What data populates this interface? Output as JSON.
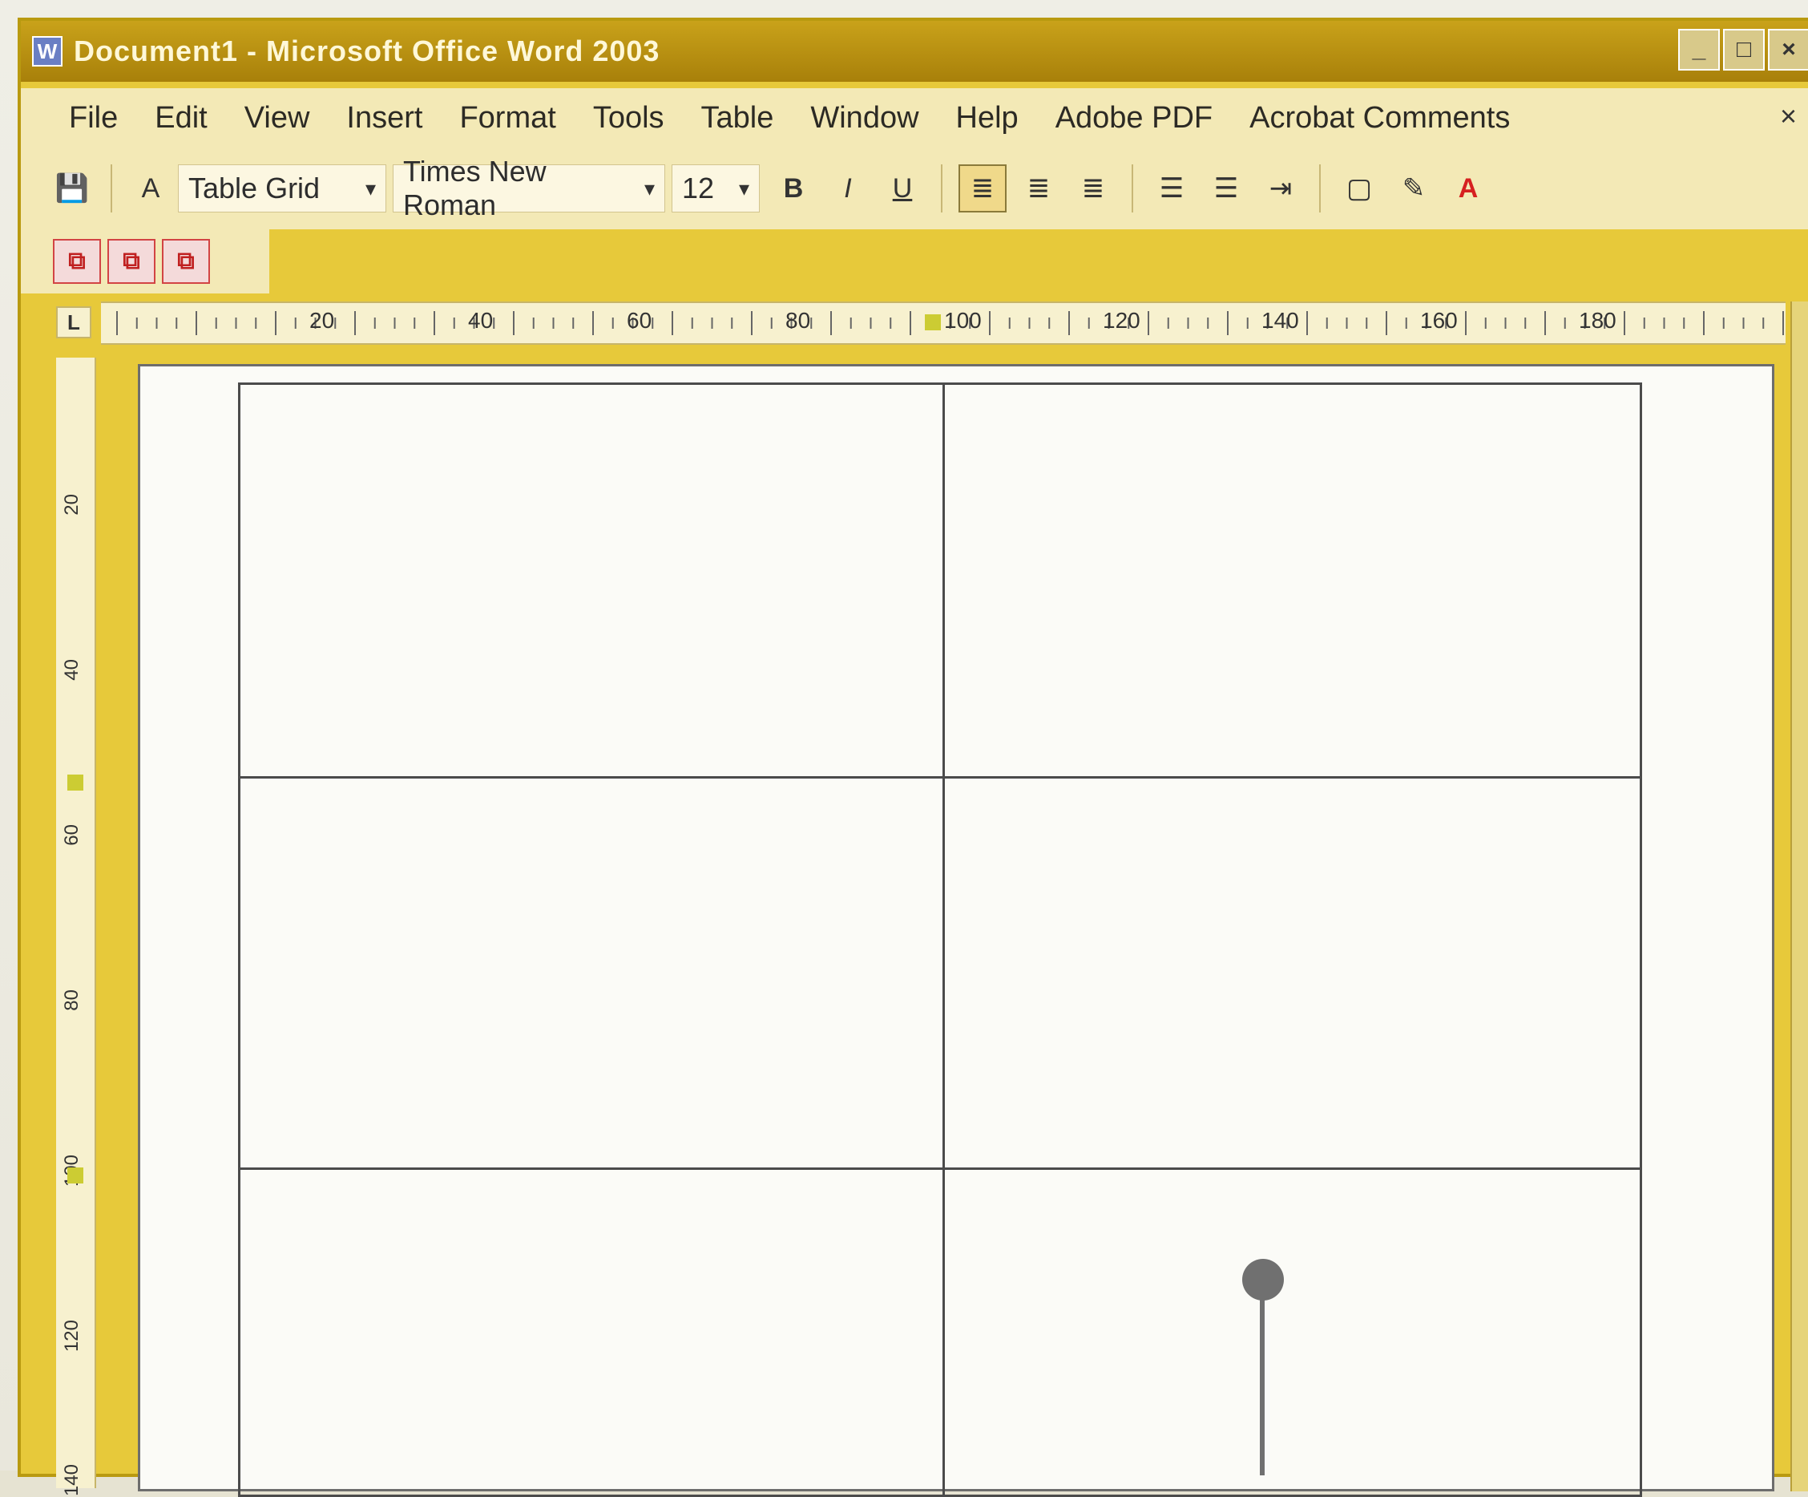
{
  "window": {
    "title": "Document1 - Microsoft Office Word 2003",
    "icon": "word-document-icon"
  },
  "menu": [
    "File",
    "Edit",
    "View",
    "Insert",
    "Format",
    "Tools",
    "Table",
    "Window",
    "Help",
    "Adobe PDF",
    "Acrobat Comments"
  ],
  "toolbar": {
    "style": "Table Grid",
    "font": "Times New Roman",
    "size": "12",
    "bold": "B",
    "italic": "I",
    "underline": "U",
    "font_color_letter": "A"
  },
  "ruler_labels": [
    "20",
    "40",
    "60",
    "80",
    "100",
    "120",
    "140",
    "160",
    "180"
  ],
  "vertical_ruler_labels": [
    "20",
    "40",
    "60",
    "80",
    "100",
    "120",
    "140"
  ],
  "corner_tab": "L"
}
